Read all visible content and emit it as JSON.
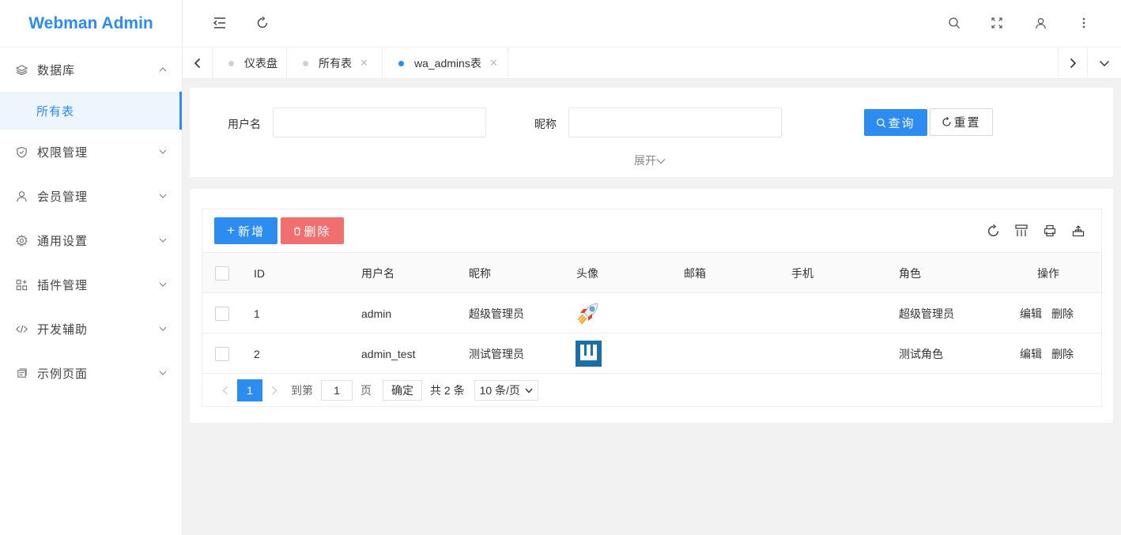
{
  "app": {
    "title": "Webman Admin"
  },
  "sidebar": {
    "items": [
      {
        "label": "数据库",
        "icon": "layers-icon",
        "expanded": true
      },
      {
        "label": "所有表",
        "sub": true,
        "active": true
      },
      {
        "label": "权限管理",
        "icon": "shield-icon"
      },
      {
        "label": "会员管理",
        "icon": "user-icon"
      },
      {
        "label": "通用设置",
        "icon": "gear-icon"
      },
      {
        "label": "插件管理",
        "icon": "apps-icon"
      },
      {
        "label": "开发辅助",
        "icon": "code-icon"
      },
      {
        "label": "示例页面",
        "icon": "page-icon"
      }
    ]
  },
  "tabs": [
    {
      "label": "仪表盘",
      "active": false,
      "closable": false
    },
    {
      "label": "所有表",
      "active": false,
      "closable": true
    },
    {
      "label": "wa_admins表",
      "active": true,
      "closable": true
    }
  ],
  "search": {
    "username_label": "用户名",
    "nickname_label": "昵称",
    "query_label": "查询",
    "reset_label": "重置",
    "expand_label": "展开"
  },
  "toolbar": {
    "add_label": "新增",
    "delete_label": "删除"
  },
  "table": {
    "columns": [
      "ID",
      "用户名",
      "昵称",
      "头像",
      "邮箱",
      "手机",
      "角色",
      "操作"
    ],
    "rows": [
      {
        "id": "1",
        "username": "admin",
        "nickname": "超级管理员",
        "avatar": "rocket-avatar",
        "email": "",
        "mobile": "",
        "role": "超级管理员",
        "edit": "编辑",
        "delete": "删除"
      },
      {
        "id": "2",
        "username": "admin_test",
        "nickname": "测试管理员",
        "avatar": "w-logo-avatar",
        "email": "",
        "mobile": "",
        "role": "测试角色",
        "edit": "编辑",
        "delete": "删除"
      }
    ]
  },
  "pager": {
    "current_page": "1",
    "goto_prefix": "到第",
    "goto_value": "1",
    "goto_suffix": "页",
    "confirm_label": "确定",
    "total_text": "共 2 条",
    "page_size": "10 条/页"
  },
  "colors": {
    "primary": "#2d8cf0",
    "danger": "#f26f6f"
  }
}
